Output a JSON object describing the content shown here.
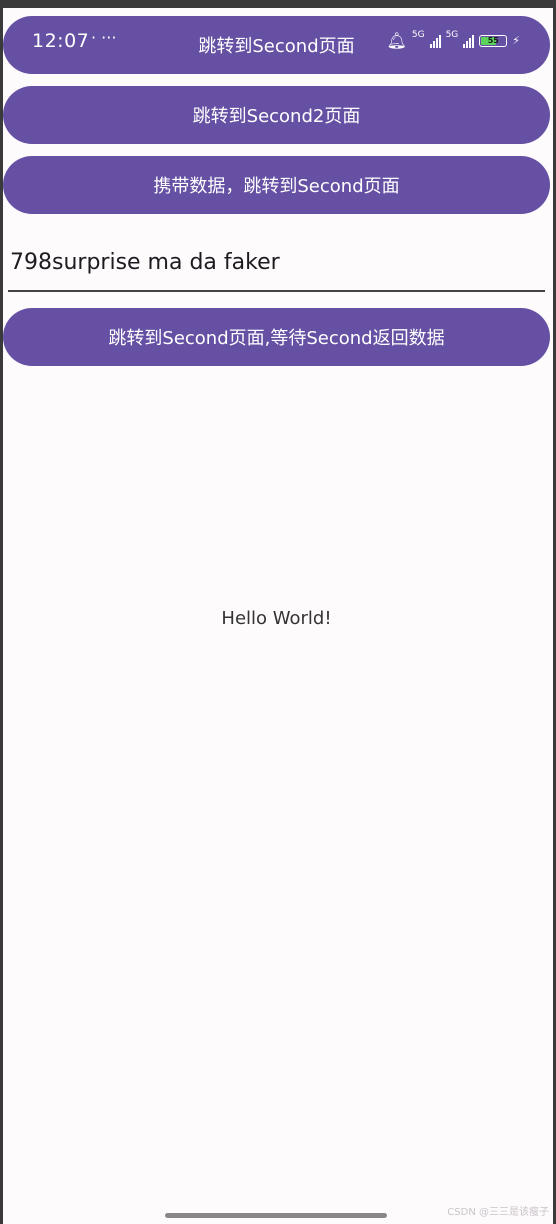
{
  "status_bar": {
    "time": "12:07",
    "dots": "· ···",
    "network_1": "5G",
    "network_2": "5G",
    "battery": "55"
  },
  "buttons": {
    "go_second": "跳转到Second页面",
    "go_second2": "跳转到Second2页面",
    "carry_data": "携带数据，跳转到Second页面",
    "wait_result": "跳转到Second页面,等待Second返回数据"
  },
  "input": {
    "value": "798surprise ma da faker"
  },
  "hello_text": "Hello World!",
  "watermark": "CSDN @三三是该瘦子",
  "colors": {
    "button_bg": "#6650a4",
    "screen_bg": "#fefbfd",
    "battery_fill": "#5bd35a"
  }
}
